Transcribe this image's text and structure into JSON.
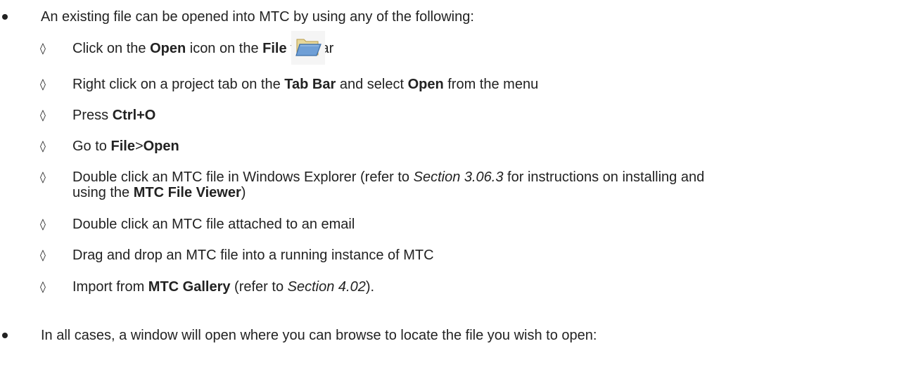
{
  "intro": {
    "text": "An existing file can be opened into MTC by using any of the following:"
  },
  "items": [
    {
      "before": "Click on the ",
      "b1": "Open",
      "mid": " icon on the ",
      "b2": "File",
      "after": " toolbar"
    },
    {
      "before": "Right click on a project tab on the ",
      "b1": "Tab Bar",
      "mid": " and select ",
      "b2": "Open",
      "after": " from the menu"
    },
    {
      "before": "Press ",
      "b1": "Ctrl+O"
    },
    {
      "before": "Go to ",
      "b1": "File",
      "mid": ">",
      "b2": "Open"
    },
    {
      "line1_before": "Double click an MTC file in Windows Explorer (refer to ",
      "line1_italic": "Section 3.06.3",
      "line1_after": " for instructions on installing and",
      "line2_before": "using the ",
      "line2_bold": "MTC File Viewer",
      "line2_after": ")"
    },
    {
      "before": "Double click an MTC file attached to an email"
    },
    {
      "before": "Drag and drop an MTC file into a running instance of MTC"
    },
    {
      "before": "Import from ",
      "b1": "MTC Gallery",
      "mid": " (refer to ",
      "i1": "Section 4.02",
      "after": ")."
    }
  ],
  "closing": {
    "text": "In all cases, a window will open where you can browse to locate the file you wish to open:"
  },
  "icons": {
    "bullet": "bullet-dot",
    "sub_bullet": "◊",
    "folder": "folder-open-icon"
  }
}
